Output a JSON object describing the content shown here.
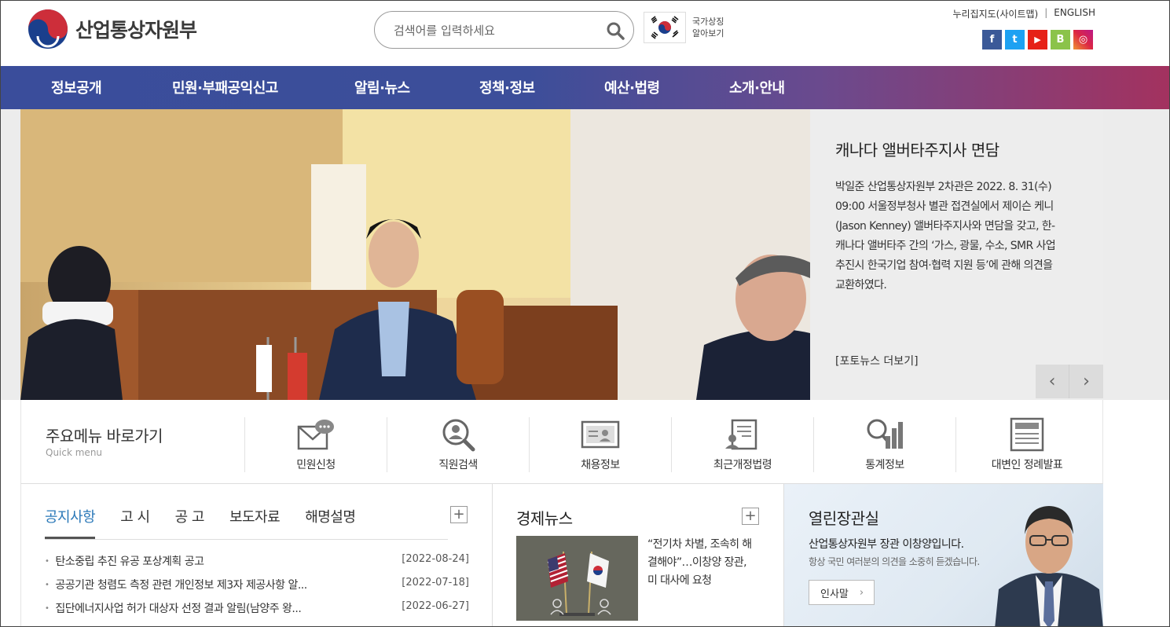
{
  "header": {
    "logo_text": "산업통상자원부",
    "search_placeholder": "검색어를 입력하세요",
    "symbol_line1": "국가상징",
    "symbol_line2": "알아보기",
    "sitemap": "누리집지도(사이트맵)",
    "separator": "|",
    "english": "ENGLISH",
    "sns": [
      {
        "label": "f",
        "color": "#3b5998"
      },
      {
        "label": "t",
        "color": "#1da1f2"
      },
      {
        "label": "▶",
        "color": "#e62117"
      },
      {
        "label": "B",
        "color": "#8bc34a"
      },
      {
        "label": "◎",
        "color": "#c13584"
      }
    ]
  },
  "nav": [
    "정보공개",
    "민원·부패공익신고",
    "알림·뉴스",
    "정책·정보",
    "예산·법령",
    "소개·안내"
  ],
  "hero": {
    "title": "캐나다 앨버타주지사 면담",
    "description": "박일준 산업통상자원부 2차관은 2022. 8. 31(수) 09:00 서울정부청사 별관 접견실에서 제이슨 케니(Jason Kenney) 앨버타주지사와 면담을 갖고, 한-캐나다 앨버타주 간의 ‘가스, 광물, 수소, SMR 사업 추진시 한국기업 참여·협력 지원 등’에 관해 의견을 교환하였다.",
    "more": "[포토뉴스 더보기]",
    "prev": "‹",
    "next": "›"
  },
  "quick": {
    "title": "주요메뉴 바로가기",
    "subtitle": "Quick menu",
    "items": [
      "민원신청",
      "직원검색",
      "채용정보",
      "최근개정법령",
      "통계정보",
      "대변인 정례발표"
    ]
  },
  "notice": {
    "tabs": [
      "공지사항",
      "고 시",
      "공 고",
      "보도자료",
      "해명설명"
    ],
    "plus": "+",
    "rows": [
      {
        "title": "탄소중립 추진 유공 포상계획 공고",
        "date": "[2022-08-24]"
      },
      {
        "title": "공공기관 청렴도 측정 관련 개인정보 제3자 제공사항 알...",
        "date": "[2022-07-18]"
      },
      {
        "title": "집단에너지사업 허가 대상자 선정 결과 알림(남양주 왕...",
        "date": "[2022-06-27]"
      }
    ]
  },
  "econ": {
    "title": "경제뉴스",
    "plus": "+",
    "text": "“전기차 차별, 조속히 해결해야”…이창양 장관, 미 대사에 요청"
  },
  "minister": {
    "title": "열린장관실",
    "line1": "산업통상자원부 장관 이창양입니다.",
    "line2": "항상 국민 여러분의 의견을 소중히 듣겠습니다.",
    "button": "인사말",
    "button_arrow": "›"
  }
}
